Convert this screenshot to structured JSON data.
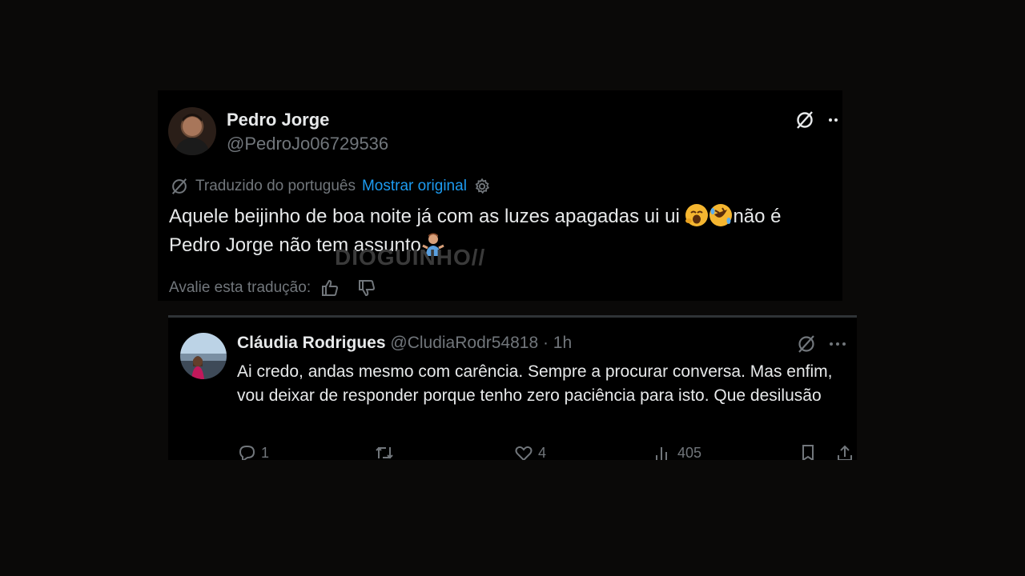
{
  "tweet": {
    "author_name": "Pedro Jorge",
    "author_handle": "@PedroJo06729536",
    "translated_label": "Traduzido do português",
    "show_original_label": "Mostrar original",
    "text_line1": "Aquele beijinho de boa noite já com as luzes apagadas ui ui ",
    "text_line1_tail": "não é",
    "text_line2": "Pedro Jorge não tem assunto",
    "rate_label": "Avalie esta tradução:"
  },
  "watermark": "DIOGUINHO//",
  "reply": {
    "author_name": "Cláudia Rodrigues",
    "author_handle": "@CludiaRodr54818",
    "time": "· 1h",
    "text": "Ai credo, andas mesmo com carência. Sempre a procurar conversa. Mas enfim, vou deixar de responder porque tenho zero paciência para isto. Que desilusão",
    "replies_count": "1",
    "likes_count": "4",
    "views_count": "405"
  },
  "colors": {
    "link": "#1d9bf0",
    "muted": "#71767b",
    "text": "#e7e9ea",
    "background": "#000000"
  },
  "icons": [
    "grok-icon",
    "more-icon",
    "translate-icon",
    "settings-icon",
    "thumbs-up-icon",
    "thumbs-down-icon",
    "reply-icon",
    "retweet-icon",
    "like-icon",
    "views-icon",
    "bookmark-icon",
    "share-icon"
  ]
}
